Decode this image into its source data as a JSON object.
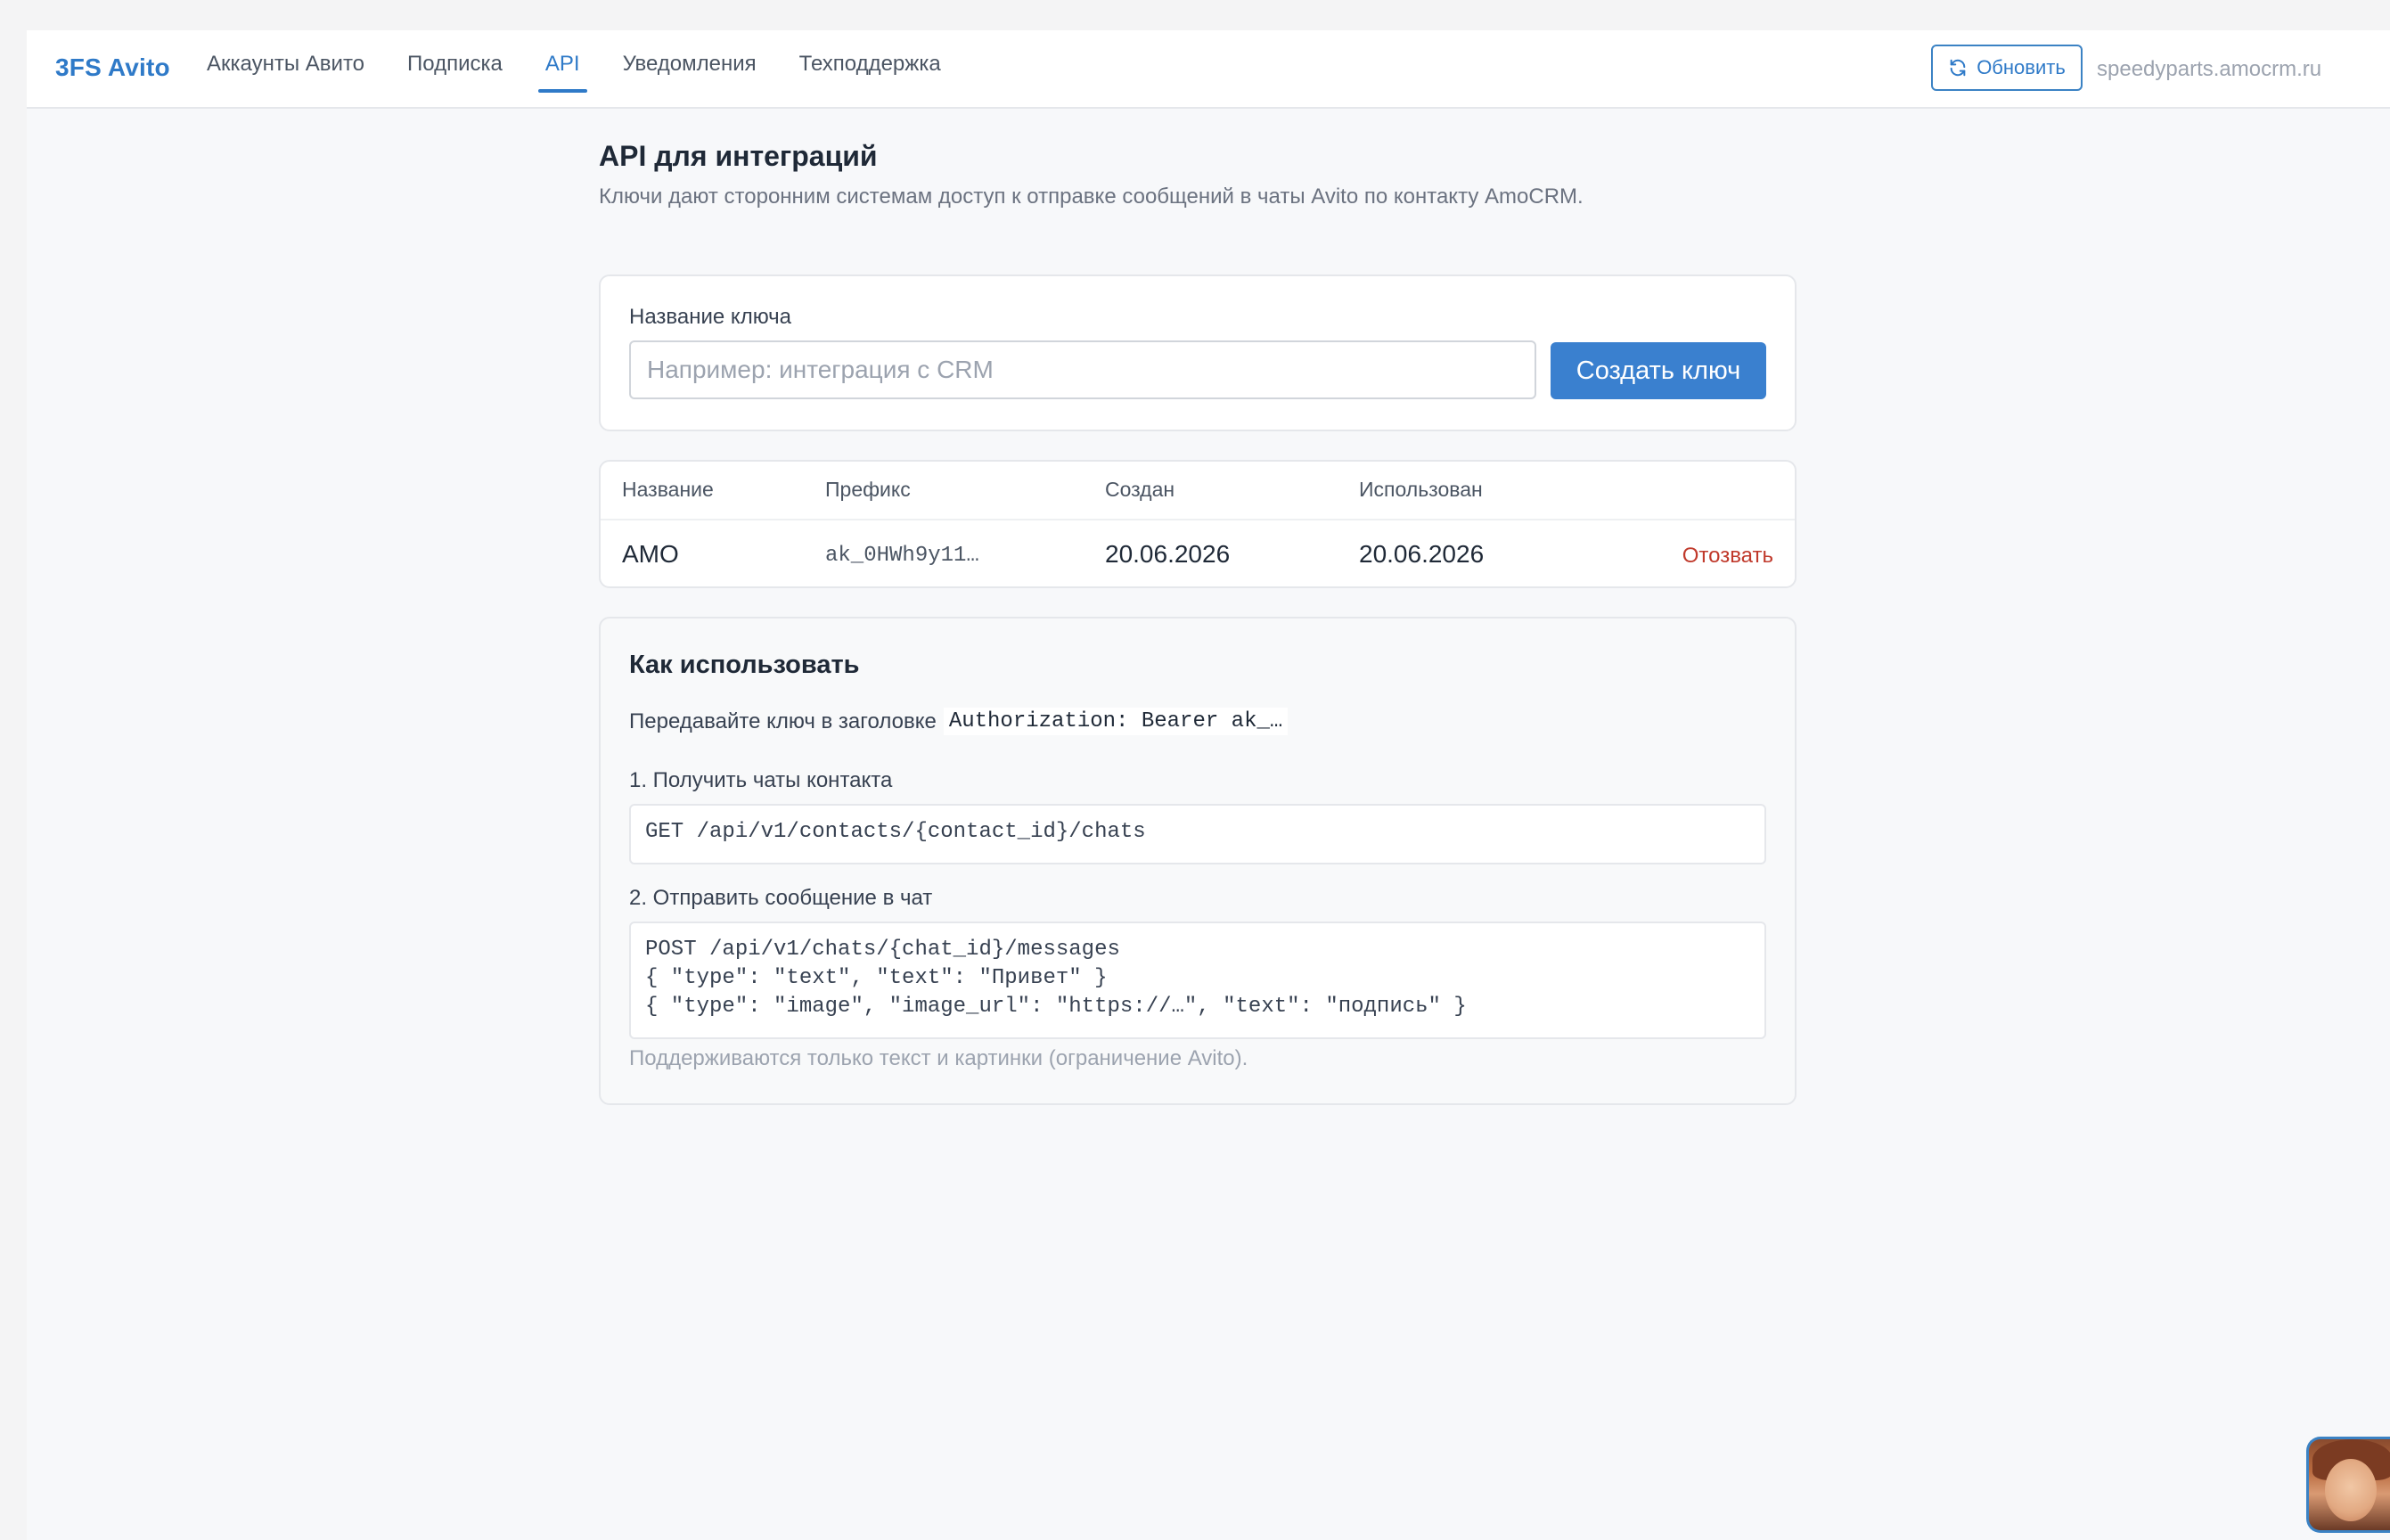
{
  "header": {
    "brand": "3FS Avito",
    "nav": [
      {
        "label": "Аккаунты Авито",
        "active": false
      },
      {
        "label": "Подписка",
        "active": false
      },
      {
        "label": "API",
        "active": true
      },
      {
        "label": "Уведомления",
        "active": false
      },
      {
        "label": "Техподдержка",
        "active": false
      }
    ],
    "refresh_label": "Обновить",
    "refresh_icon": "refresh-icon",
    "domain": "speedyparts.amocrm.ru"
  },
  "page": {
    "title": "API для интеграций",
    "subtitle": "Ключи дают сторонним системам доступ к отправке сообщений в чаты Avito по контакту AmoCRM."
  },
  "create": {
    "label": "Название ключа",
    "placeholder": "Например: интеграция с CRM",
    "value": "",
    "button": "Создать ключ"
  },
  "keys_table": {
    "columns": [
      "Название",
      "Префикс",
      "Создан",
      "Использован"
    ],
    "rows": [
      {
        "name": "AMO",
        "prefix": "ak_0HWh9y11…",
        "created": "20.06.2026",
        "used": "20.06.2026",
        "action": "Отозвать"
      }
    ]
  },
  "usage": {
    "title": "Как использовать",
    "intro": "Передавайте ключ в заголовке",
    "header_code": "Authorization: Bearer ak_…",
    "step1_label": "1. Получить чаты контакта",
    "step1_code": "GET /api/v1/contacts/{contact_id}/chats",
    "step2_label": "2. Отправить сообщение в чат",
    "step2_code": "POST /api/v1/chats/{chat_id}/messages\n{ \"type\": \"text\", \"text\": \"Привет\" }\n{ \"type\": \"image\", \"image_url\": \"https://…\", \"text\": \"подпись\" }",
    "note": "Поддерживаются только текст и картинки (ограничение Avito)."
  },
  "colors": {
    "accent": "#2f7ac8",
    "primary_button": "#3a80cf",
    "danger": "#c0392b"
  }
}
